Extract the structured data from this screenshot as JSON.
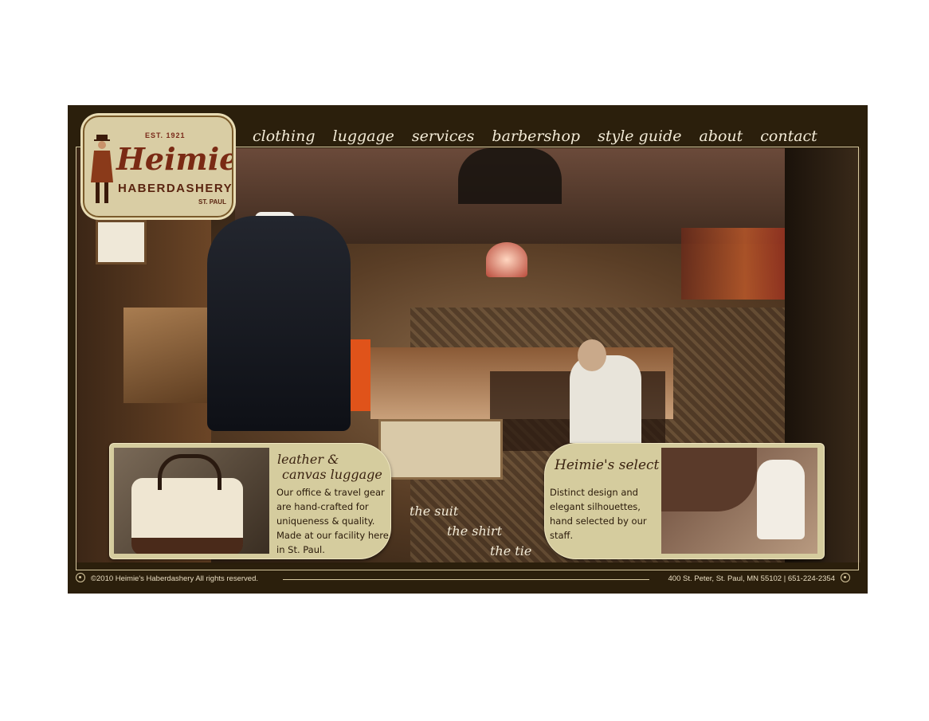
{
  "brand": {
    "est": "EST. 1921",
    "name": "Heimie's",
    "subtitle": "HABERDASHERY",
    "city": "ST. PAUL"
  },
  "nav": [
    {
      "label": "clothing"
    },
    {
      "label": "luggage"
    },
    {
      "label": "services"
    },
    {
      "label": "barbershop"
    },
    {
      "label": "style guide"
    },
    {
      "label": "about"
    },
    {
      "label": "contact"
    }
  ],
  "panels": {
    "left": {
      "title_line1": "leather &",
      "title_line2": "canvas luggage",
      "text": "Our office & travel gear are hand-crafted for uniqueness & quality. Made at our facility here in St. Paul."
    },
    "right": {
      "title": "Heimie's select",
      "text": "Distinct design and elegant silhouettes, hand selected by our staff."
    }
  },
  "taglines": [
    "the suit",
    "the shirt",
    "the tie"
  ],
  "footer": {
    "copyright": "©2010 Heimie's Haberdashery All rights reserved.",
    "address": "400 St. Peter, St. Paul, MN 55102 | 651-224-2354"
  },
  "colors": {
    "frame": "#2b1f0c",
    "panel": "#d5cc9e",
    "logo_text": "#7a2a14",
    "nav_text": "#f2ead6"
  }
}
